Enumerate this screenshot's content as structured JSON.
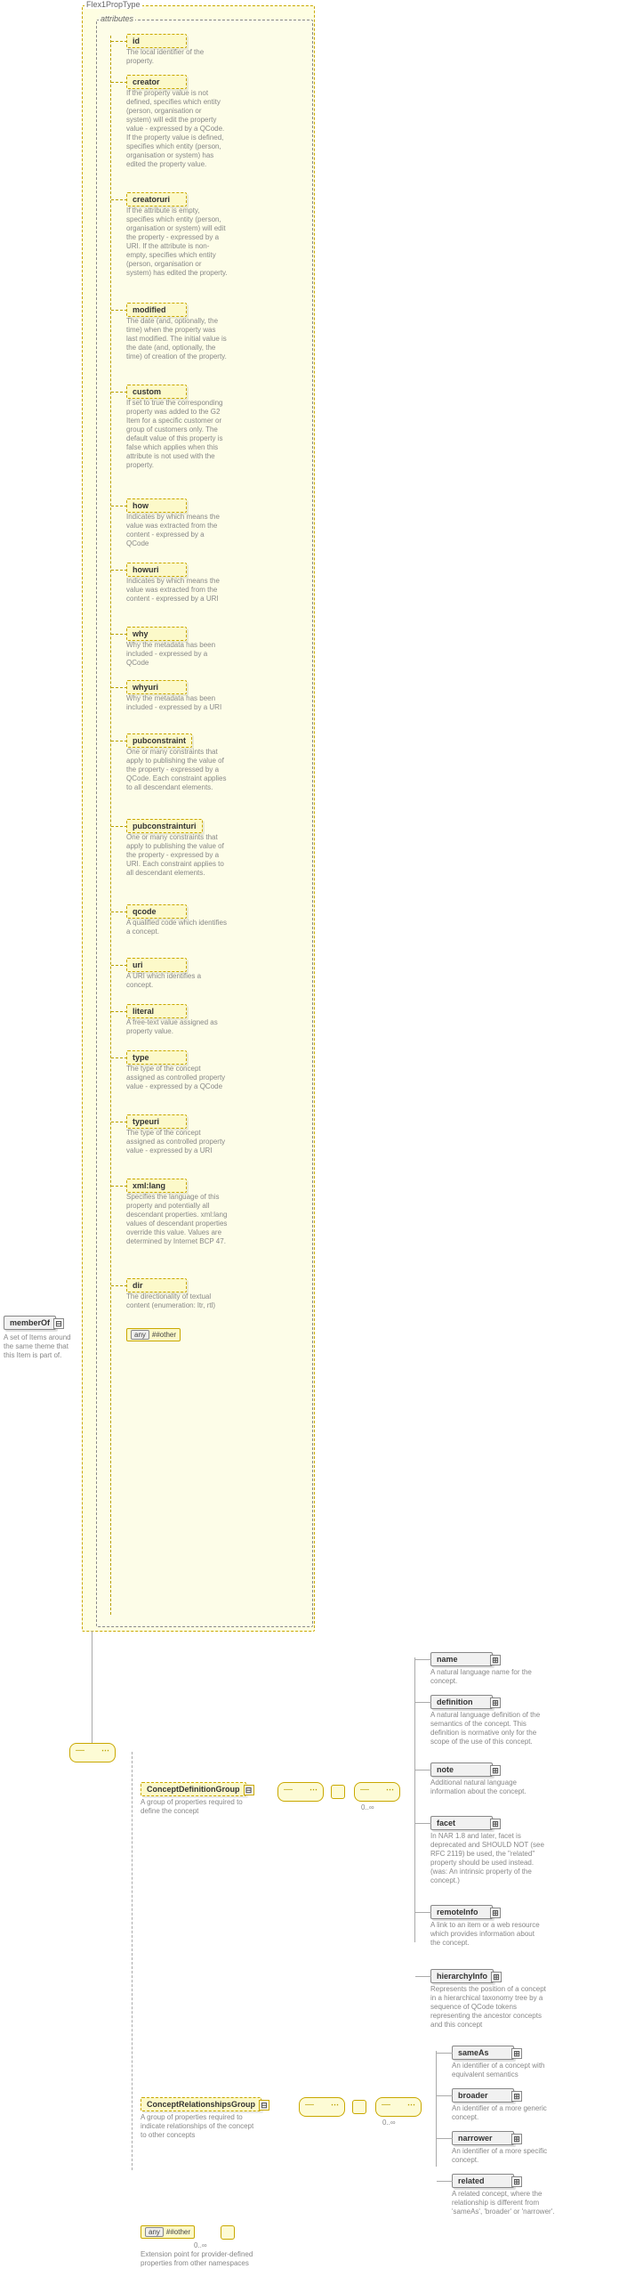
{
  "root": {
    "title": "Flex1PropType",
    "attributes_label": "attributes"
  },
  "member": {
    "label": "memberOf",
    "desc": "A set of Items around the same theme that this Item is part of."
  },
  "attrs": [
    {
      "name": "id",
      "desc": "The local identifier of the property."
    },
    {
      "name": "creator",
      "desc": "If the property value is not defined, specifies which entity (person, organisation or system) will edit the property value - expressed by a QCode. If the property value is defined, specifies which entity (person, organisation or system) has edited the property value."
    },
    {
      "name": "creatoruri",
      "desc": "If the attribute is empty, specifies which entity (person, organisation or system) will edit the property - expressed by a URI. If the attribute is non-empty, specifies which entity (person, organisation or system) has edited the property."
    },
    {
      "name": "modified",
      "desc": "The date (and, optionally, the time) when the property was last modified. The initial value is the date (and, optionally, the time) of creation of the property."
    },
    {
      "name": "custom",
      "desc": "If set to true the corresponding property was added to the G2 Item for a specific customer or group of customers only. The default value of this property is false which applies when this attribute is not used with the property."
    },
    {
      "name": "how",
      "desc": "Indicates by which means the value was extracted from the content - expressed by a QCode"
    },
    {
      "name": "howuri",
      "desc": "Indicates by which means the value was extracted from the content - expressed by a URI"
    },
    {
      "name": "why",
      "desc": "Why the metadata has been included - expressed by a QCode"
    },
    {
      "name": "whyuri",
      "desc": "Why the metadata has been included - expressed by a URI"
    },
    {
      "name": "pubconstraint",
      "desc": "One or many constraints that apply to publishing the value of the property - expressed by a QCode. Each constraint applies to all descendant elements."
    },
    {
      "name": "pubconstrainturi",
      "desc": "One or many constraints that apply to publishing the value of the property - expressed by a URI. Each constraint applies to all descendant elements."
    },
    {
      "name": "qcode",
      "desc": "A qualified code which identifies a concept."
    },
    {
      "name": "uri",
      "desc": "A URI which identifies a concept."
    },
    {
      "name": "literal",
      "desc": "A free-text value assigned as property value."
    },
    {
      "name": "type",
      "desc": "The type of the concept assigned as controlled property value - expressed by a QCode"
    },
    {
      "name": "typeuri",
      "desc": "The type of the concept assigned as controlled property value - expressed by a URI"
    },
    {
      "name": "xml:lang",
      "desc": "Specifies the language of this property and potentially all descendant properties. xml:lang values of descendant properties override this value. Values are determined by Internet BCP 47."
    },
    {
      "name": "dir",
      "desc": "The directionality of textual content (enumeration: ltr, rtl)"
    }
  ],
  "any_hash": "any ##other",
  "groups": {
    "def": {
      "label": "ConceptDefinitionGroup",
      "desc": "A group of properties required to define the concept"
    },
    "rel": {
      "label": "ConceptRelationshipsGroup",
      "desc": "A group of properties required to indicate relationships of the concept to other concepts"
    }
  },
  "def_children": [
    {
      "name": "name",
      "desc": "A natural language name for the concept."
    },
    {
      "name": "definition",
      "desc": "A natural language definition of the semantics of the concept. This definition is normative only for the scope of the use of this concept."
    },
    {
      "name": "note",
      "desc": "Additional natural language information about the concept."
    },
    {
      "name": "facet",
      "desc": "In NAR 1.8 and later, facet is deprecated and SHOULD NOT (see RFC 2119) be used, the \"related\" property should be used instead.(was: An intrinsic property of the concept.)"
    },
    {
      "name": "remoteInfo",
      "desc": "A link to an item or a web resource which provides information about the concept."
    },
    {
      "name": "hierarchyInfo",
      "desc": "Represents the position of a concept in a hierarchical taxonomy tree by a sequence of QCode tokens representing the ancestor concepts and this concept"
    }
  ],
  "rel_children": [
    {
      "name": "sameAs",
      "desc": "An identifier of a concept with equivalent semantics"
    },
    {
      "name": "broader",
      "desc": "An identifier of a more generic concept."
    },
    {
      "name": "narrower",
      "desc": "An identifier of a more specific concept."
    },
    {
      "name": "related",
      "desc": "A related concept, where the relationship is different from 'sameAs', 'broader' or 'narrower'."
    }
  ],
  "ext": {
    "label": "any ##other",
    "desc": "Extension point for provider-defined properties from other namespaces"
  },
  "card": "0..∞"
}
